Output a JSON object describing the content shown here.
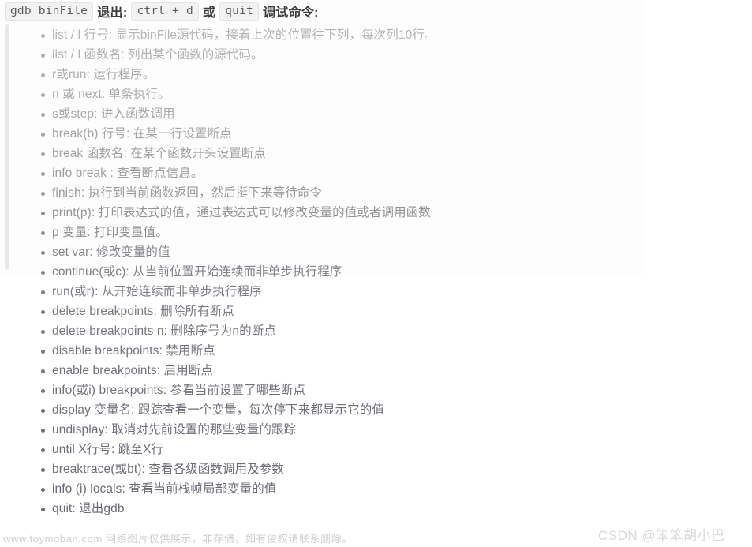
{
  "header": {
    "segments": [
      {
        "type": "code",
        "text": "gdb binFile",
        "name": "badge-gdb-binfile"
      },
      {
        "type": "cn",
        "text": "退出:",
        "name": "header-label-exit"
      },
      {
        "type": "code",
        "text": "ctrl + d",
        "name": "badge-ctrl-d"
      },
      {
        "type": "cn",
        "text": "或",
        "name": "header-label-or"
      },
      {
        "type": "code",
        "text": "quit",
        "name": "badge-quit"
      },
      {
        "type": "cn",
        "text": "调试命令:",
        "name": "header-label-debug-commands"
      }
    ]
  },
  "commands": [
    {
      "text": "list / l 行号: 显示binFile源代码，接着上次的位置往下列，每次列10行。",
      "color": "#b4b4b4"
    },
    {
      "text": "list / l 函数名: 列出某个函数的源代码。",
      "color": "#b1b1b1"
    },
    {
      "text": "r或run: 运行程序。",
      "color": "#aeaeae"
    },
    {
      "text": "n 或 next: 单条执行。",
      "color": "#ababab"
    },
    {
      "text": "s或step: 进入函数调用",
      "color": "#a8a8a8"
    },
    {
      "text": "break(b) 行号: 在某一行设置断点",
      "color": "#a5a5a5"
    },
    {
      "text": "break 函数名: 在某个函数开头设置断点",
      "color": "#a2a2a2"
    },
    {
      "text": "info break : 查看断点信息。",
      "color": "#9e9e9e"
    },
    {
      "text": "finish: 执行到当前函数返回，然后挺下来等待命令",
      "color": "#9a9a9a"
    },
    {
      "text": "print(p): 打印表达式的值，通过表达式可以修改变量的值或者调用函数",
      "color": "#949494"
    },
    {
      "text": "p 变量: 打印变量值。",
      "color": "#8d8d93"
    },
    {
      "text": "set var: 修改变量的值",
      "color": "#87878e"
    },
    {
      "text": "continue(或c): 从当前位置开始连续而非单步执行程序",
      "color": "#818189"
    },
    {
      "text": "run(或r): 从开始连续而非单步执行程序",
      "color": "#7d7d86"
    },
    {
      "text": "delete breakpoints: 删除所有断点",
      "color": "#7a7a83"
    },
    {
      "text": "delete breakpoints n: 删除序号为n的断点",
      "color": "#777781"
    },
    {
      "text": "disable breakpoints: 禁用断点",
      "color": "#75757f"
    },
    {
      "text": "enable breakpoints: 启用断点",
      "color": "#73737d"
    },
    {
      "text": "info(或i) breakpoints: 参看当前设置了哪些断点",
      "color": "#71717c"
    },
    {
      "text": "display 变量名: 跟踪查看一个变量，每次停下来都显示它的值",
      "color": "#6f6f7a"
    },
    {
      "text": "undisplay: 取消对先前设置的那些变量的跟踪",
      "color": "#6e6e79"
    },
    {
      "text": "until X行号: 跳至X行",
      "color": "#6d6d78"
    },
    {
      "text": "breaktrace(或bt): 查看各级函数调用及参数",
      "color": "#6c6c77"
    },
    {
      "text": "info  (i) locals: 查看当前栈帧局部变量的值",
      "color": "#6b6b76"
    },
    {
      "text": "quit: 退出gdb",
      "color": "#6a6a76"
    }
  ],
  "watermarks": {
    "left": "www.toymoban.com 网络图片仅供展示，非存储，如有侵权请联系删除。",
    "right": "CSDN @笨笨胡小巴"
  }
}
